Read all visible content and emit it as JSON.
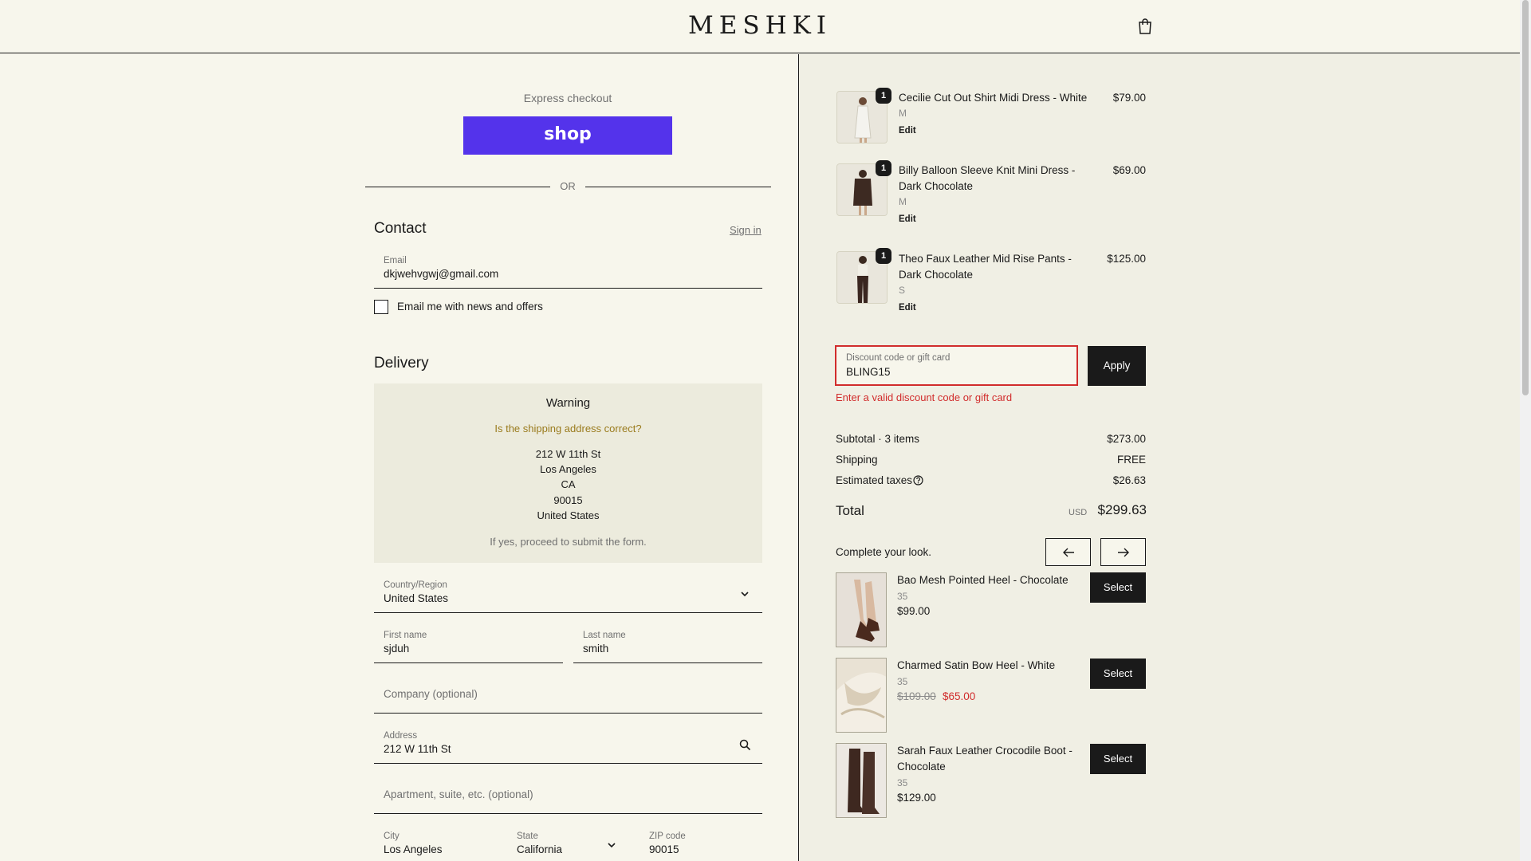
{
  "header": {
    "logo": "MESHKI",
    "cart_icon": "shopping-bag-icon"
  },
  "express": {
    "title": "Express checkout",
    "shop_label": "shop",
    "or_label": "OR"
  },
  "contact": {
    "title": "Contact",
    "sign_in": "Sign in",
    "email_label": "Email",
    "email_value": "dkjwehvgwj@gmail.com",
    "newsletter_label": "Email me with news and offers",
    "newsletter_checked": false
  },
  "delivery": {
    "title": "Delivery",
    "warning": {
      "title": "Warning",
      "question": "Is the shipping address correct?",
      "address_lines": [
        "212 W 11th St",
        "Los Angeles",
        "CA",
        "90015",
        "United States"
      ],
      "footer": "If yes, proceed to submit the form."
    },
    "country": {
      "label": "Country/Region",
      "value": "United States"
    },
    "first_name": {
      "label": "First name",
      "value": "sjduh"
    },
    "last_name": {
      "label": "Last name",
      "value": "smith"
    },
    "company": {
      "placeholder": "Company (optional)"
    },
    "address": {
      "label": "Address",
      "value": "212 W 11th St"
    },
    "apartment": {
      "placeholder": "Apartment, suite, etc. (optional)"
    },
    "city": {
      "label": "City",
      "value": "Los Angeles"
    },
    "state": {
      "label": "State",
      "value": "California"
    },
    "zip": {
      "label": "ZIP code",
      "value": "90015"
    }
  },
  "cart": {
    "items": [
      {
        "name": "Cecilie Cut Out Shirt Midi Dress - White",
        "variant": "M",
        "qty": "1",
        "price": "$79.00",
        "edit": "Edit"
      },
      {
        "name": "Billy Balloon Sleeve Knit Mini Dress - Dark Chocolate",
        "variant": "M",
        "qty": "1",
        "price": "$69.00",
        "edit": "Edit"
      },
      {
        "name": "Theo Faux Leather Mid Rise Pants - Dark Chocolate",
        "variant": "S",
        "qty": "1",
        "price": "$125.00",
        "edit": "Edit"
      }
    ],
    "discount": {
      "label": "Discount code or gift card",
      "value": "BLING15",
      "apply": "Apply",
      "error": "Enter a valid discount code or gift card"
    },
    "summary": {
      "subtotal_label": "Subtotal · 3 items",
      "subtotal_value": "$273.00",
      "shipping_label": "Shipping",
      "shipping_value": "FREE",
      "taxes_label": "Estimated taxes",
      "taxes_value": "$26.63",
      "total_label": "Total",
      "currency": "USD",
      "total_value": "$299.63"
    },
    "recommendations": {
      "title": "Complete your look.",
      "items": [
        {
          "name": "Bao Mesh Pointed Heel - Chocolate",
          "size": "35",
          "price": "$99.00",
          "select": "Select"
        },
        {
          "name": "Charmed Satin Bow Heel - White",
          "size": "35",
          "old_price": "$109.00",
          "sale_price": "$65.00",
          "select": "Select"
        },
        {
          "name": "Sarah Faux Leather Crocodile Boot - Chocolate",
          "size": "35",
          "price": "$129.00",
          "select": "Select"
        }
      ]
    }
  },
  "colors": {
    "shop_pay": "#5433eb",
    "error": "#d12c2c",
    "warning_text": "#9a7b1d",
    "background": "#f7f6ec",
    "panel": "#f0efe4"
  }
}
